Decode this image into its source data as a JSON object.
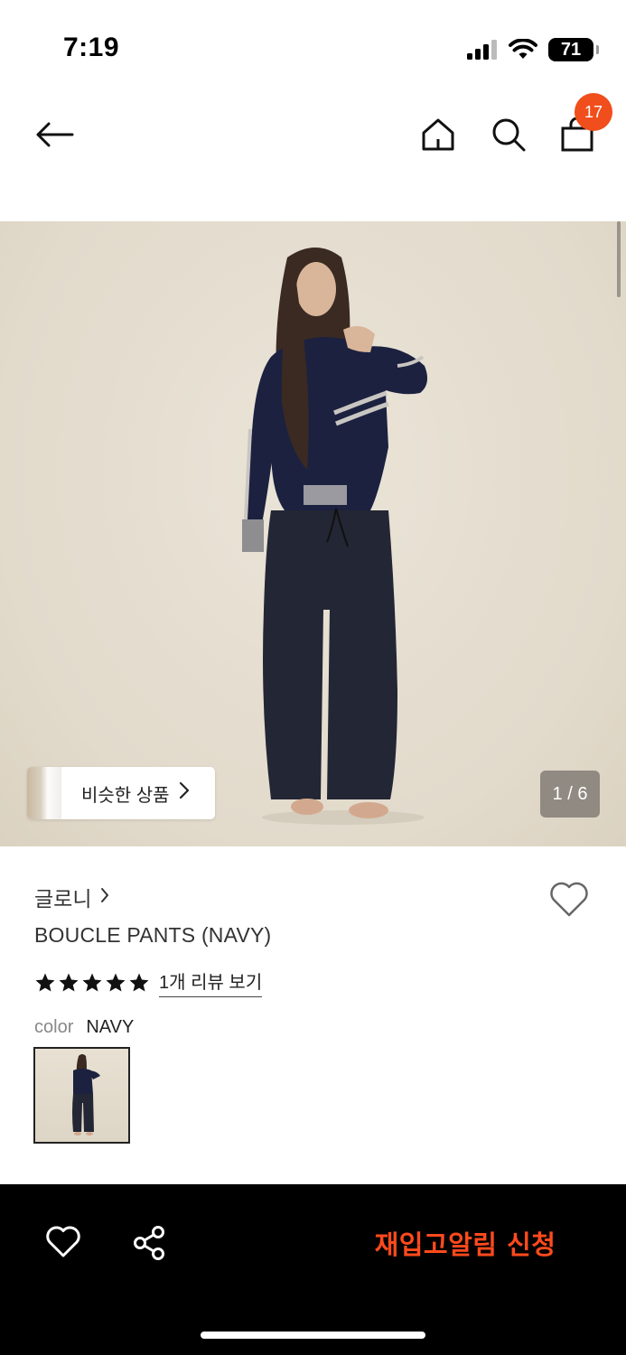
{
  "status_bar": {
    "time": "7:19",
    "battery": "71"
  },
  "nav": {
    "cart_count": "17"
  },
  "gallery": {
    "similar_label": "비슷한 상품",
    "page_indicator": "1 / 6"
  },
  "product": {
    "brand": "글로니",
    "name": "BOUCLE PANTS (NAVY)",
    "rating_stars": 5,
    "review_link": "1개 리뷰 보기",
    "color_label": "color",
    "color_value": "NAVY"
  },
  "bottom_bar": {
    "restock_label": "재입고알림 신청"
  },
  "colors": {
    "accent": "#f04e1c",
    "restock_text": "#ff4a1c",
    "bottom_bar_bg": "#000000",
    "image_bg": "#e6dfd2"
  },
  "icons": [
    "signal-icon",
    "wifi-icon",
    "battery-icon",
    "back-arrow-icon",
    "home-icon",
    "search-icon",
    "shopping-bag-icon",
    "heart-icon",
    "star-icon",
    "share-icon",
    "chevron-right-icon"
  ]
}
